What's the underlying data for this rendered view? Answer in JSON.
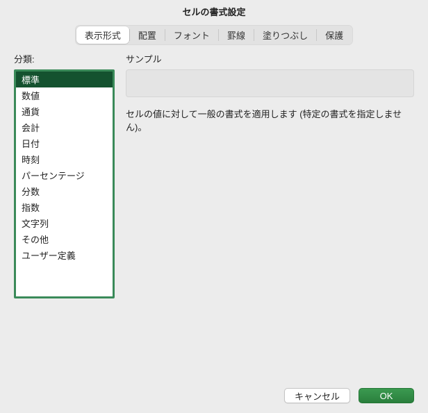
{
  "dialog": {
    "title": "セルの書式設定"
  },
  "tabs": [
    {
      "label": "表示形式",
      "active": true
    },
    {
      "label": "配置",
      "active": false
    },
    {
      "label": "フォント",
      "active": false
    },
    {
      "label": "罫線",
      "active": false
    },
    {
      "label": "塗りつぶし",
      "active": false
    },
    {
      "label": "保護",
      "active": false
    }
  ],
  "left": {
    "label": "分類:"
  },
  "categories": [
    {
      "label": "標準",
      "selected": true
    },
    {
      "label": "数値",
      "selected": false
    },
    {
      "label": "通貨",
      "selected": false
    },
    {
      "label": "会計",
      "selected": false
    },
    {
      "label": "日付",
      "selected": false
    },
    {
      "label": "時刻",
      "selected": false
    },
    {
      "label": "パーセンテージ",
      "selected": false
    },
    {
      "label": "分数",
      "selected": false
    },
    {
      "label": "指数",
      "selected": false
    },
    {
      "label": "文字列",
      "selected": false
    },
    {
      "label": "その他",
      "selected": false
    },
    {
      "label": "ユーザー定義",
      "selected": false
    }
  ],
  "right": {
    "sample_label": "サンプル",
    "description": "セルの値に対して一般の書式を適用します (特定の書式を指定しません)。"
  },
  "footer": {
    "cancel": "キャンセル",
    "ok": "OK"
  }
}
